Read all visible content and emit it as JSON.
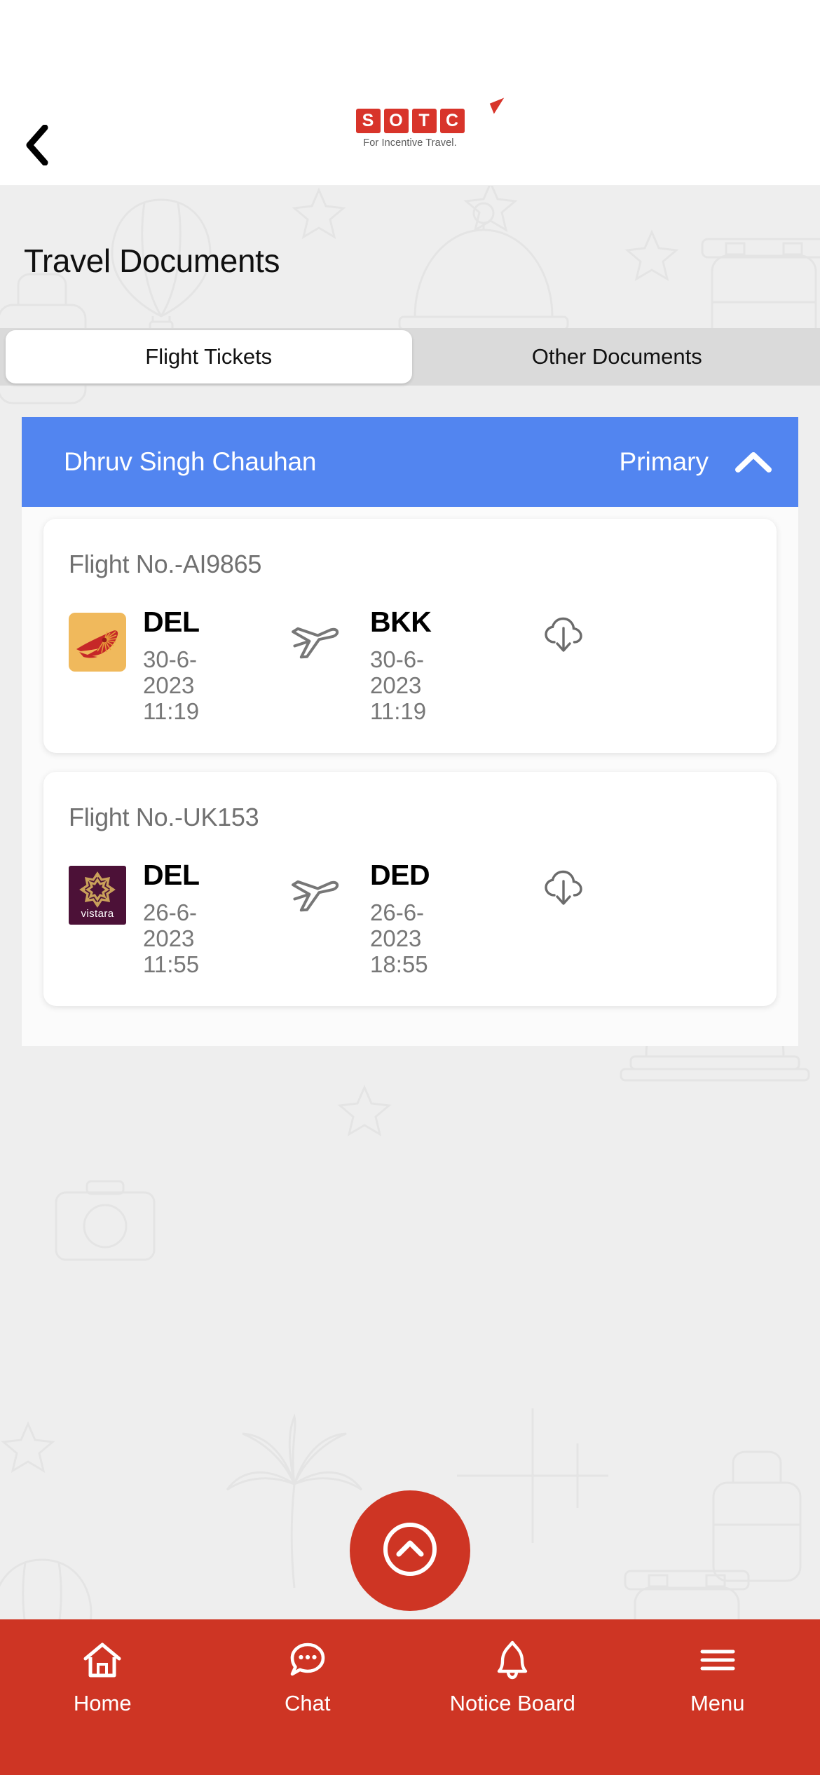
{
  "header": {
    "back_icon": "chevron-left-icon",
    "brand_letters": [
      "S",
      "O",
      "T",
      "C"
    ],
    "brand_tagline": "For Incentive Travel."
  },
  "page": {
    "title": "Travel Documents"
  },
  "tabs": [
    {
      "label": "Flight Tickets",
      "active": true
    },
    {
      "label": "Other Documents",
      "active": false
    }
  ],
  "passenger": {
    "name": "Dhruv Singh Chauhan",
    "role": "Primary",
    "chevron_icon": "chevron-up-icon",
    "expanded": true,
    "bar_color": "#5285F0"
  },
  "flights": [
    {
      "flight_no_label": "Flight No.-AI9865",
      "airline": "air-india",
      "airline_logo_bg": "#F0B95C",
      "departure": {
        "code": "DEL",
        "date": "30-6-2023",
        "time": "11:19"
      },
      "arrival": {
        "code": "BKK",
        "date": "30-6-2023",
        "time": "11:19"
      },
      "plane_icon": "airplane-icon",
      "download_icon": "cloud-download-icon"
    },
    {
      "flight_no_label": "Flight No.-UK153",
      "airline": "vistara",
      "airline_logo_bg": "#4C1137",
      "airline_wordmark": "vistara",
      "departure": {
        "code": "DEL",
        "date": "26-6-2023",
        "time": "11:55"
      },
      "arrival": {
        "code": "DED",
        "date": "26-6-2023",
        "time": "18:55"
      },
      "plane_icon": "airplane-icon",
      "download_icon": "cloud-download-icon"
    }
  ],
  "fab": {
    "icon": "chevron-up-circle-icon",
    "color": "#CE3524"
  },
  "bottom_nav": {
    "bar_color": "#CE3524",
    "items": [
      {
        "label": "Home",
        "icon": "home-icon"
      },
      {
        "label": "Chat",
        "icon": "chat-bubble-icon"
      },
      {
        "label": "Notice Board",
        "icon": "bell-icon"
      },
      {
        "label": "Menu",
        "icon": "hamburger-menu-icon"
      }
    ]
  }
}
